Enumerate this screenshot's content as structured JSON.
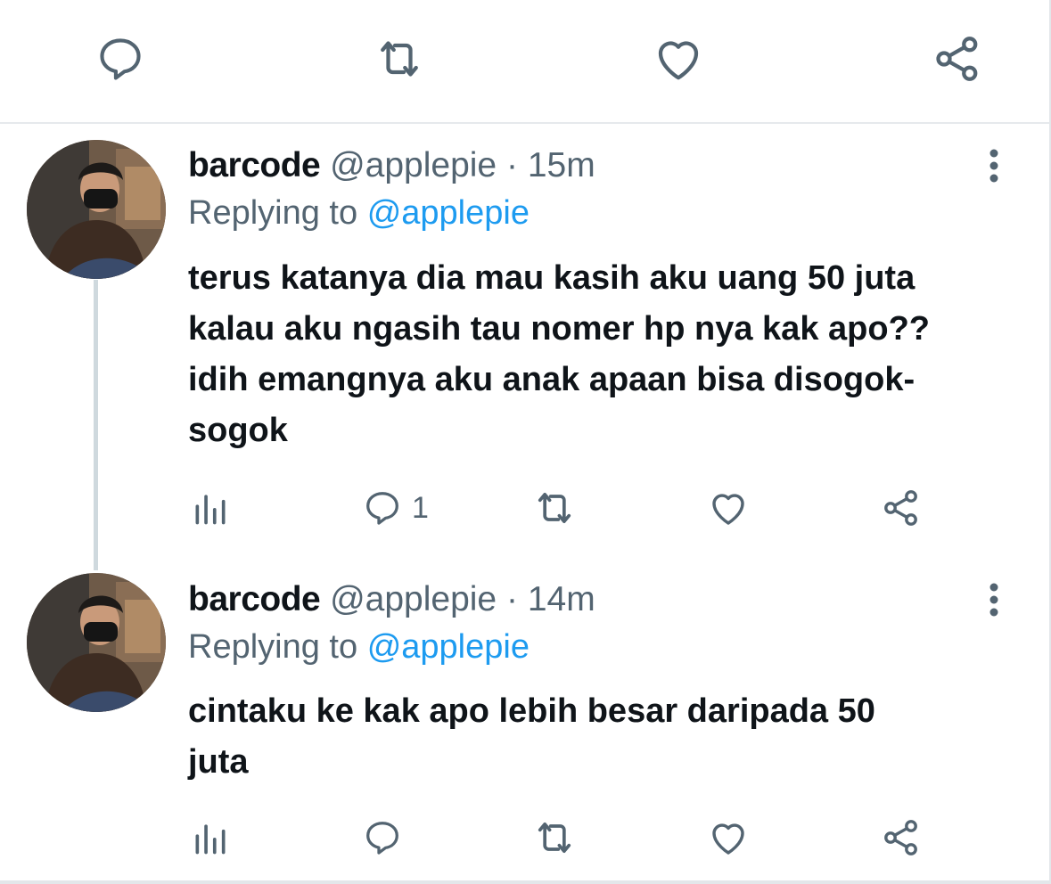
{
  "top_actions": {
    "icons": [
      "reply-icon",
      "retweet-icon",
      "like-icon",
      "share-icon"
    ]
  },
  "tweets": [
    {
      "name": "barcode",
      "handle": "@applepie",
      "separator": "·",
      "time": "15m",
      "replying_prefix": "Replying to",
      "replying_to": "@applepie",
      "text": "terus katanya dia mau kasih aku uang 50 juta\nkalau aku ngasih tau nomer hp nya kak apo??\nidih emangnya aku anak apaan bisa disogok-\nsogok",
      "reply_count": "1"
    },
    {
      "name": "barcode",
      "handle": "@applepie",
      "separator": "·",
      "time": "14m",
      "replying_prefix": "Replying to",
      "replying_to": "@applepie",
      "text": "cintaku ke kak apo lebih besar daripada 50\njuta",
      "reply_count": ""
    }
  ],
  "colors": {
    "text": "#0f1419",
    "secondary": "#536471",
    "accent": "#1d9bf0",
    "icon": "#536471",
    "divider": "#e6e9ec"
  }
}
